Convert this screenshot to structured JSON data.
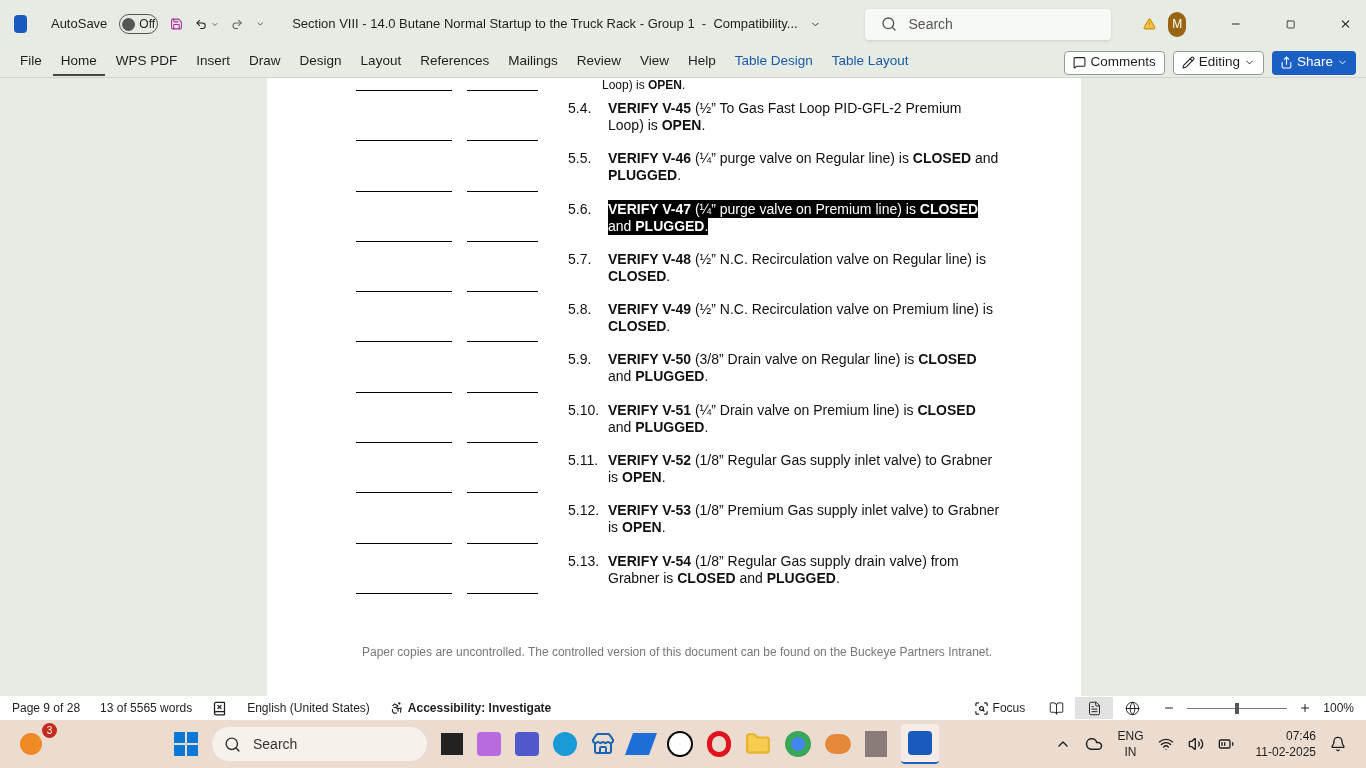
{
  "title_bar": {
    "autosave_label": "AutoSave",
    "autosave": {
      "on": false,
      "label": "Off"
    },
    "document_title": "Section VIII - 14.0 Butane Normal Startup to the Truck Rack - Group 1  -  Compatibility...",
    "search_placeholder": "Search",
    "avatar_initial": "M"
  },
  "ribbon_tabs": [
    {
      "label": "File",
      "selected": false,
      "kind": "plain"
    },
    {
      "label": "Home",
      "selected": true,
      "kind": "plain"
    },
    {
      "label": "WPS PDF",
      "selected": false,
      "kind": "plain"
    },
    {
      "label": "Insert",
      "selected": false,
      "kind": "plain"
    },
    {
      "label": "Draw",
      "selected": false,
      "kind": "plain"
    },
    {
      "label": "Design",
      "selected": false,
      "kind": "plain"
    },
    {
      "label": "Layout",
      "selected": false,
      "kind": "plain"
    },
    {
      "label": "References",
      "selected": false,
      "kind": "plain"
    },
    {
      "label": "Mailings",
      "selected": false,
      "kind": "plain"
    },
    {
      "label": "Review",
      "selected": false,
      "kind": "plain"
    },
    {
      "label": "View",
      "selected": false,
      "kind": "plain"
    },
    {
      "label": "Help",
      "selected": false,
      "kind": "plain"
    },
    {
      "label": "Table Design",
      "selected": false,
      "kind": "contextual"
    },
    {
      "label": "Table Layout",
      "selected": false,
      "kind": "contextual"
    }
  ],
  "ribbon_buttons": {
    "comments": "Comments",
    "editing": "Editing",
    "share": "Share"
  },
  "document": {
    "partial_line": "Loop) is **OPEN**.",
    "steps": [
      {
        "number": "5.4.",
        "text": "**VERIFY V-45** (½” To Gas Fast Loop PID-GFL-2 Premium Loop) is **OPEN**.",
        "selected": false
      },
      {
        "number": "5.5.",
        "text": "**VERIFY V-46** (¼” purge valve on Regular line) is **CLOSED** and **PLUGGED**.",
        "selected": false
      },
      {
        "number": "5.6.",
        "text": "**VERIFY V-47** (¼” purge valve on Premium line) is **CLOSED** and **PLUGGED**.",
        "selected": true
      },
      {
        "number": "5.7.",
        "text": "**VERIFY V-48** (½” N.C. Recirculation valve on Regular line) is **CLOSED**.",
        "selected": false
      },
      {
        "number": "5.8.",
        "text": "**VERIFY V-49** (½” N.C. Recirculation valve on Premium line) is **CLOSED**.",
        "selected": false
      },
      {
        "number": "5.9.",
        "text": "**VERIFY V-50** (3/8” Drain valve on Regular line) is **CLOSED** and **PLUGGED**.",
        "selected": false
      },
      {
        "number": "5.10.",
        "text": "**VERIFY V-51** (¼” Drain valve on Premium line) is **CLOSED** and **PLUGGED**.",
        "selected": false
      },
      {
        "number": "5.11.",
        "text": "**VERIFY V-52** (1/8” Regular Gas supply inlet valve) to Grabner is **OPEN**.",
        "selected": false
      },
      {
        "number": "5.12.",
        "text": "**VERIFY V-53** (1/8” Premium Gas supply inlet valve) to Grabner is **OPEN**.",
        "selected": false
      },
      {
        "number": "5.13.",
        "text": "**VERIFY V-54** (1/8” Regular Gas supply drain valve) from Grabner is **CLOSED** and **PLUGGED**.",
        "selected": false
      }
    ],
    "footer": "Paper copies are uncontrolled. The controlled version of this document can be found on the Buckeye Partners Intranet."
  },
  "status_bar": {
    "page": "Page 9 of 28",
    "words": "13 of 5565 words",
    "language": "English (United States)",
    "accessibility": "Accessibility: Investigate",
    "focus": "Focus",
    "views": [
      {
        "kind": "read",
        "selected": false
      },
      {
        "kind": "print",
        "selected": true
      },
      {
        "kind": "web",
        "selected": false
      }
    ],
    "zoom": {
      "level": 0.5,
      "reading": "100%"
    }
  },
  "taskbar": {
    "weather_badge": "3",
    "search_placeholder": "Search",
    "language": "ENG",
    "region": "IN",
    "time": "07:46",
    "date": "11-02-2025"
  }
}
